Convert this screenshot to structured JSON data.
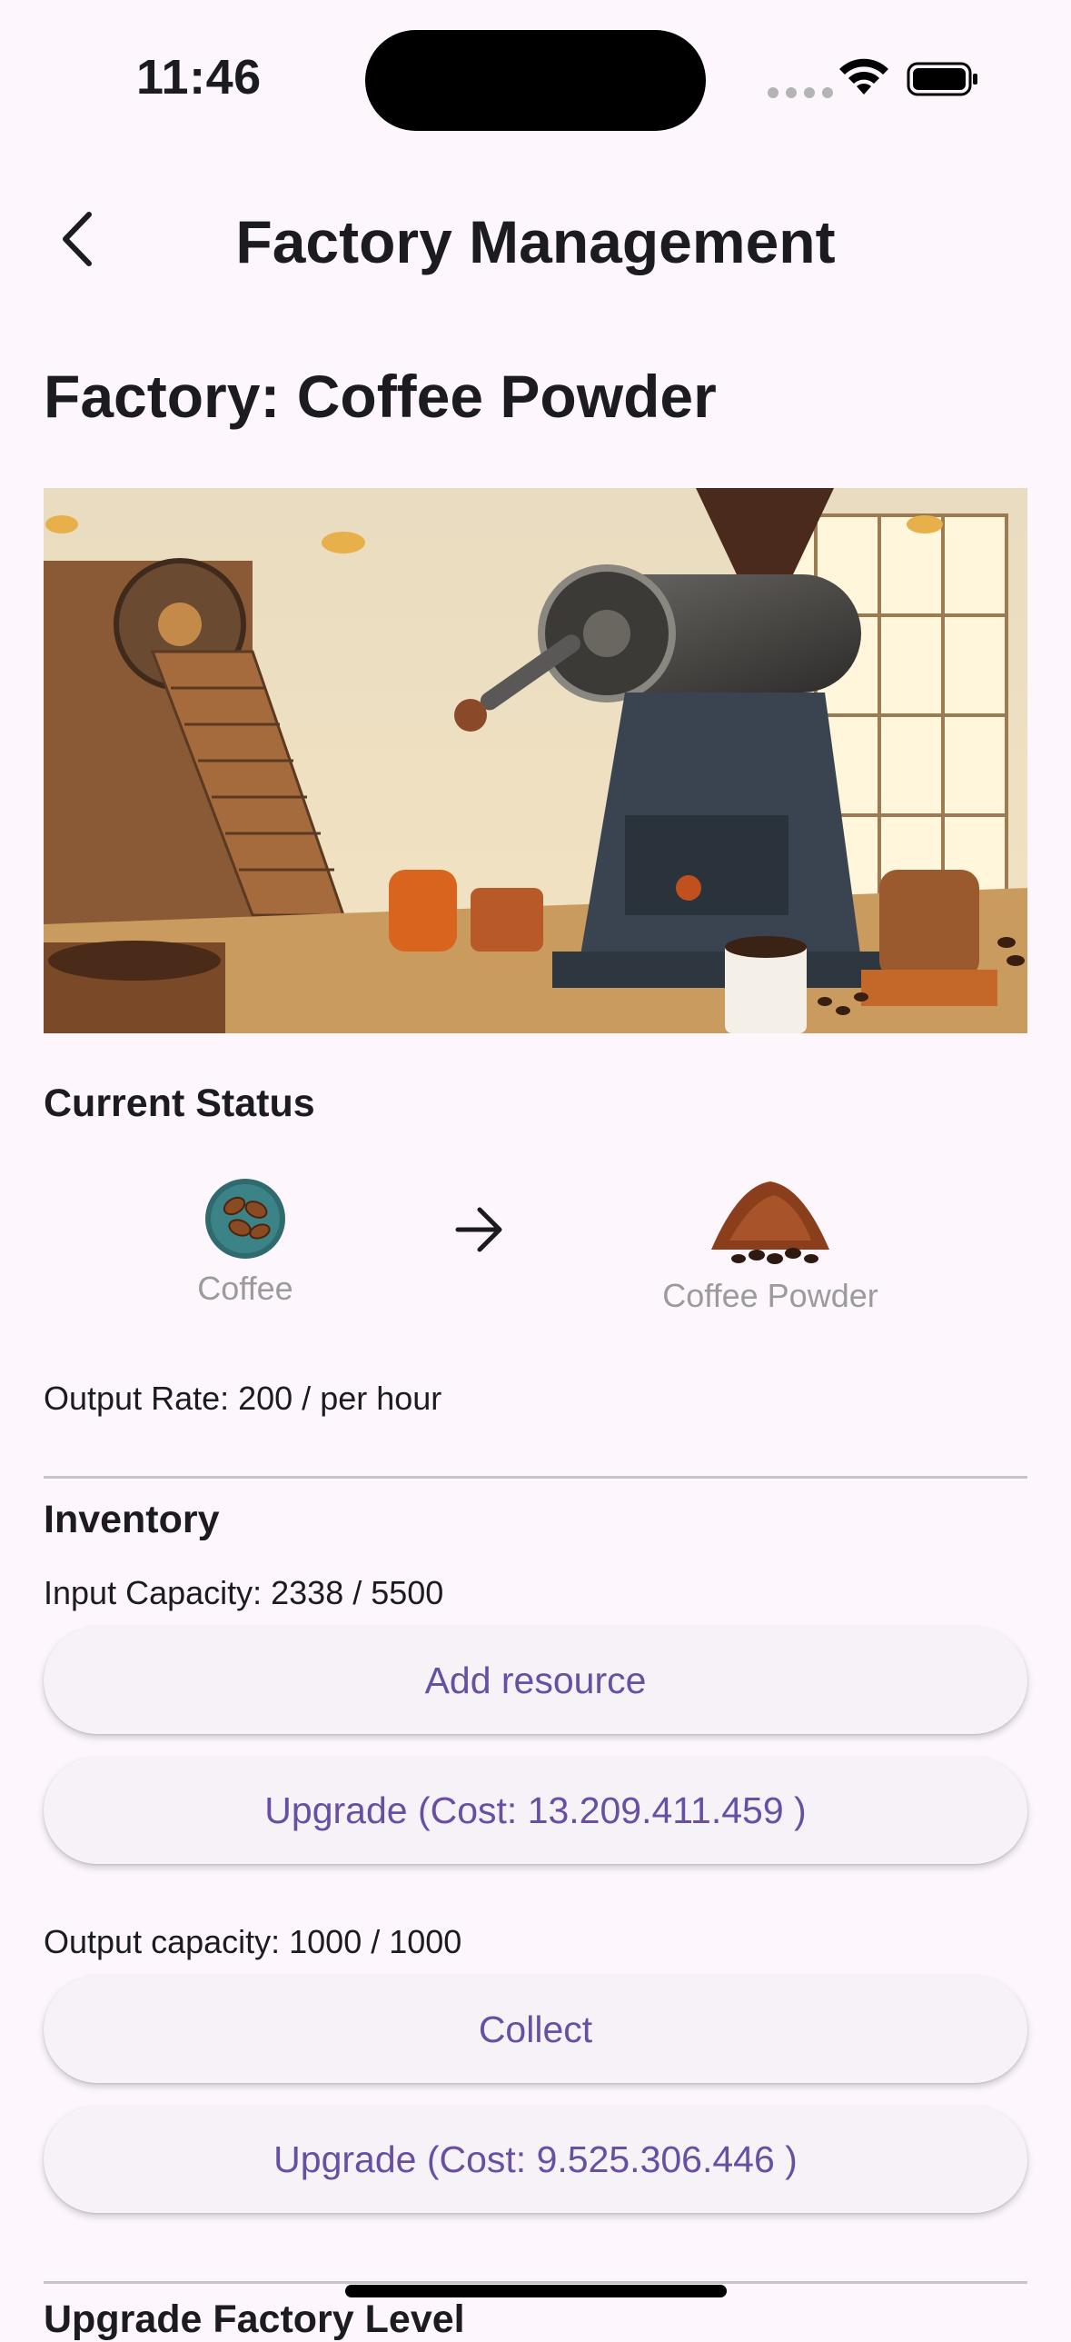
{
  "status_bar": {
    "time": "11:46"
  },
  "app_bar": {
    "title": "Factory Management"
  },
  "page": {
    "title": "Factory: Coffee Powder"
  },
  "current_status": {
    "heading": "Current Status",
    "input": {
      "label": "Coffee",
      "icon": "coffee-beans-icon"
    },
    "output": {
      "label": "Coffee Powder",
      "icon": "coffee-powder-icon"
    },
    "output_rate": "Output Rate: 200 / per hour"
  },
  "inventory": {
    "heading": "Inventory",
    "input_capacity": "Input Capacity: 2338 / 5500",
    "add_resource_label": "Add resource",
    "input_upgrade_label": "Upgrade (Cost: 13.209.411.459 )",
    "output_capacity": "Output capacity: 1000 / 1000",
    "collect_label": "Collect",
    "output_upgrade_label": "Upgrade (Cost: 9.525.306.446 )"
  },
  "upgrade_section": {
    "heading": "Upgrade Factory Level"
  },
  "colors": {
    "accent": "#6750a4",
    "background": "#fdf7fd"
  }
}
